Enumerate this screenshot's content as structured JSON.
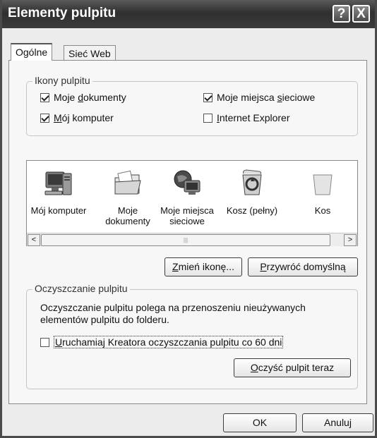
{
  "window": {
    "title": "Elementy pulpitu"
  },
  "titlebar": {
    "help": "?",
    "close": "X"
  },
  "tabs": [
    {
      "label": "Ogólne"
    },
    {
      "label": "Sieć Web"
    }
  ],
  "desktop_icons_group": {
    "legend": "Ikony pulpitu",
    "checkboxes": [
      {
        "pre": "Moje ",
        "key": "d",
        "post": "okumenty",
        "checked": true
      },
      {
        "pre": "Moje miejsca ",
        "key": "s",
        "post": "ieciowe",
        "checked": true
      },
      {
        "pre": "",
        "key": "M",
        "post": "ój komputer",
        "checked": true
      },
      {
        "pre": "",
        "key": "I",
        "post": "nternet Explorer",
        "checked": false
      }
    ]
  },
  "icon_list": {
    "items": [
      {
        "label": "Mój komputer",
        "icon": "computer-icon"
      },
      {
        "label": "Moje dokumenty",
        "icon": "folder-documents-icon"
      },
      {
        "label": "Moje miejsca sieciowe",
        "icon": "network-places-icon"
      },
      {
        "label": "Kosz (pełny)",
        "icon": "recycle-bin-full-icon"
      },
      {
        "label": "Kos",
        "icon": "recycle-bin-empty-icon"
      }
    ],
    "scroll_left": "<",
    "scroll_right": ">",
    "thumb_grip": "|||"
  },
  "buttons": {
    "change_icon": {
      "key": "Z",
      "post": "mień ikonę..."
    },
    "restore_default": {
      "key": "P",
      "post": "rzywróć domyślną"
    }
  },
  "cleanup_group": {
    "legend": "Oczyszczanie pulpitu",
    "description": "Oczyszczanie pulpitu polega na przenoszeniu nieużywanych elementów pulpitu do folderu.",
    "run_wizard": {
      "key": "U",
      "post": "ruchamiaj Kreatora oczyszczania pulpitu co 60 dni",
      "checked": false
    },
    "clean_now": {
      "key": "O",
      "post": "czyść pulpit teraz"
    }
  },
  "footer": {
    "ok": "OK",
    "cancel": "Anuluj"
  }
}
